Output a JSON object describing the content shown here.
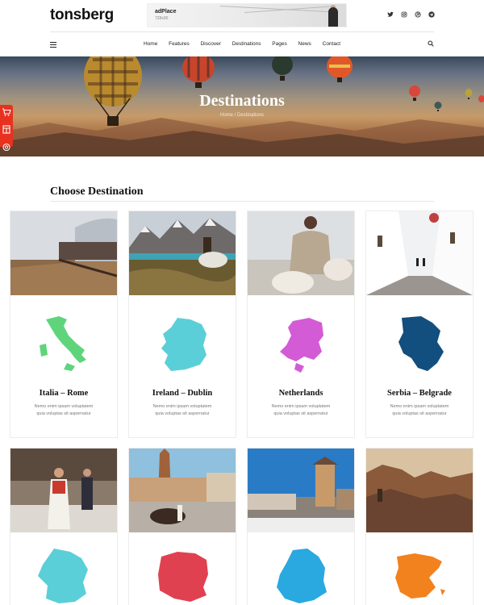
{
  "header": {
    "logo_main": "tonsberg",
    "ad": {
      "title": "adPlace",
      "size": "728x90"
    },
    "social_icons": [
      "twitter-icon",
      "instagram-icon",
      "dribbble-icon",
      "telegram-icon"
    ]
  },
  "nav": {
    "items": [
      {
        "label": "Home"
      },
      {
        "label": "Features"
      },
      {
        "label": "Discover"
      },
      {
        "label": "Destinations"
      },
      {
        "label": "Pages"
      },
      {
        "label": "News"
      },
      {
        "label": "Contact"
      }
    ]
  },
  "hero": {
    "title": "Destinations",
    "breadcrumb": "Home / Destinations"
  },
  "section": {
    "title": "Choose Destination"
  },
  "destinations": [
    {
      "name": "Italia – Rome",
      "desc_line1": "Nemo enim ipsam voluptatem",
      "desc_line2": "quia voluptas sit aspernatur",
      "map_color": "#5fd47a"
    },
    {
      "name": "Ireland – Dublin",
      "desc_line1": "Nemo enim ipsam voluptatem",
      "desc_line2": "quia voluptas sit aspernatur",
      "map_color": "#5bcfd8"
    },
    {
      "name": "Netherlands",
      "desc_line1": "Nemo enim ipsam voluptatem",
      "desc_line2": "quia voluptas sit aspernatur",
      "map_color": "#d45bd6"
    },
    {
      "name": "Serbia – Belgrade",
      "desc_line1": "Nemo enim ipsam voluptatem",
      "desc_line2": "quia voluptas sit aspernatur",
      "map_color": "#124e7e"
    },
    {
      "name": "",
      "map_color": "#5bcfd8"
    },
    {
      "name": "",
      "map_color": "#e04150"
    },
    {
      "name": "",
      "map_color": "#2aa8e0"
    },
    {
      "name": "",
      "map_color": "#f2821e"
    }
  ],
  "colors": {
    "accent": "#e53b2c",
    "side_tools": "#e8321f"
  }
}
